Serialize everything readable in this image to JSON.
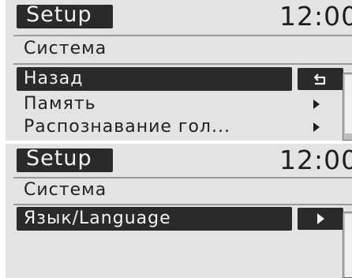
{
  "screens": [
    {
      "header": {
        "title": "Setup",
        "clock": "12:00"
      },
      "section_title": "Система",
      "menu_items": [
        {
          "label": "Назад",
          "selected": true,
          "indicator": "back-icon"
        },
        {
          "label": "Память",
          "selected": false,
          "indicator": "chevron-right-icon"
        },
        {
          "label": "Распознавание гол...",
          "selected": false,
          "indicator": "chevron-right-icon"
        }
      ]
    },
    {
      "header": {
        "title": "Setup",
        "clock": "12:00"
      },
      "section_title": "Система",
      "menu_items": [
        {
          "label": "Язык/Language",
          "selected": true,
          "indicator": "chevron-right-icon"
        }
      ]
    }
  ],
  "colors": {
    "screen_background": "#e3e3e3",
    "highlight": "#2a2a2a",
    "text_dark": "#1e1e1e",
    "text_light": "#f2f2f2"
  }
}
